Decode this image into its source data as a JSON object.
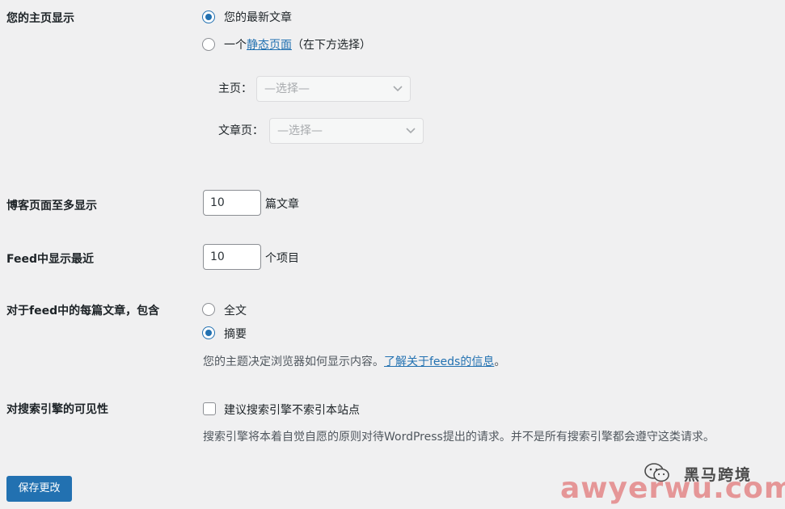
{
  "homepage_display": {
    "label": "您的主页显示",
    "option_latest": "您的最新文章",
    "option_static_prefix": "一个",
    "option_static_link": "静态页面",
    "option_static_suffix": "（在下方选择）",
    "homepage_label": "主页：",
    "homepage_select": "—选择—",
    "postspage_label": "文章页：",
    "postspage_select": "—选择—"
  },
  "blog_pages": {
    "label": "博客页面至多显示",
    "value": "10",
    "unit": "篇文章"
  },
  "feed_recent": {
    "label": "Feed中显示最近",
    "value": "10",
    "unit": "个项目"
  },
  "feed_content": {
    "label": "对于feed中的每篇文章，包含",
    "option_full": "全文",
    "option_summary": "摘要",
    "desc": "您的主题决定浏览器如何显示内容。",
    "desc_link": "了解关于feeds的信息",
    "desc_end": "。"
  },
  "search_visibility": {
    "label": "对搜索引擎的可见性",
    "checkbox_label": "建议搜索引擎不索引本站点",
    "desc": "搜索引擎将本着自觉自愿的原则对待WordPress提出的请求。并不是所有搜索引擎都会遵守这类请求。"
  },
  "save_button": "保存更改",
  "watermark": {
    "brand": "黑马跨境",
    "url": "awyerwu.com"
  },
  "colors": {
    "accent": "#2271b1",
    "background": "#f0f0f1",
    "text": "#1d2327"
  }
}
